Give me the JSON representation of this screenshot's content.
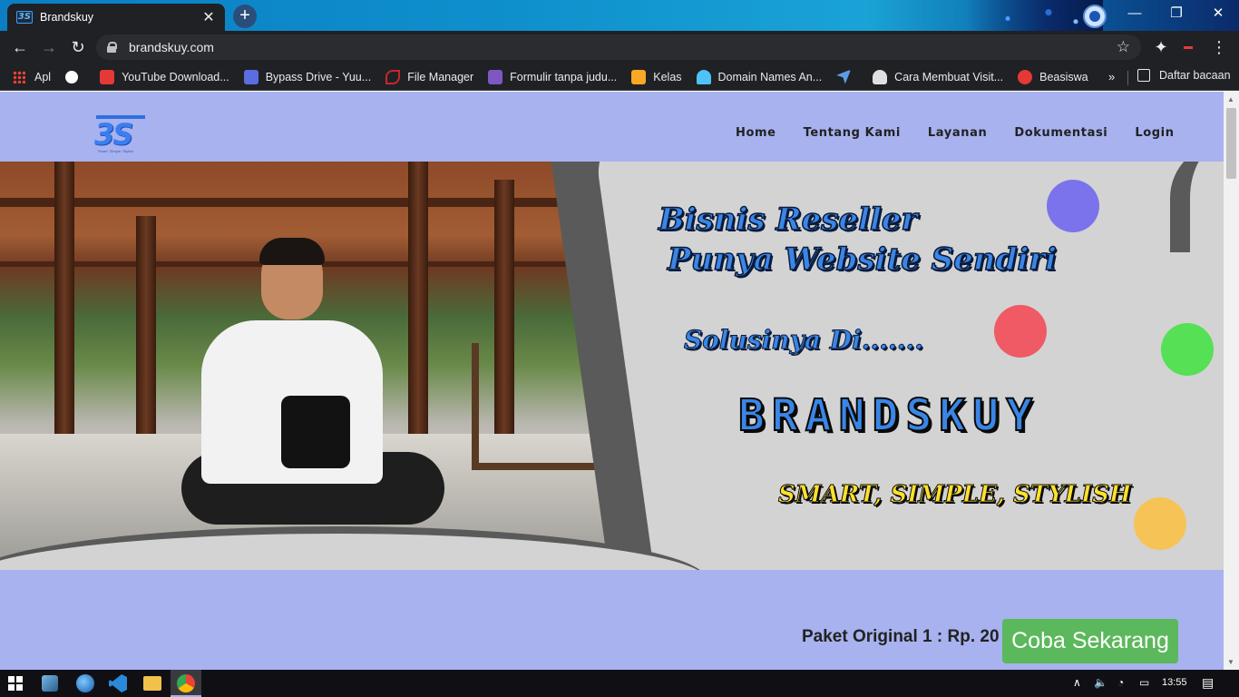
{
  "browser": {
    "tab_title": "Brandskuy",
    "tab_favicon_text": "3S",
    "tab_close": "✕",
    "new_tab": "+",
    "url": "brandskuy.com",
    "window_controls": {
      "minimize": "—",
      "restore": "❐",
      "close": "✕"
    }
  },
  "bookmarks": {
    "items": [
      {
        "label": "Apl",
        "icon": "apps-grid-icon",
        "color": "#ea4335"
      },
      {
        "label": "",
        "icon": "globe-icon",
        "color": "#ffffff"
      },
      {
        "label": "YouTube Download...",
        "icon": "download-icon",
        "color": "#e53935"
      },
      {
        "label": "Bypass Drive - Yuu...",
        "icon": "bypass-icon",
        "color": "#5b6ee1"
      },
      {
        "label": "File Manager",
        "icon": "file-manager-icon",
        "color": "#c62828"
      },
      {
        "label": "Formulir tanpa judu...",
        "icon": "forms-icon",
        "color": "#7e57c2"
      },
      {
        "label": "Kelas",
        "icon": "classroom-icon",
        "color": "#f9a825"
      },
      {
        "label": "Domain Names An...",
        "icon": "domain-icon",
        "color": "#4fc3f7"
      },
      {
        "label": "",
        "icon": "send-icon",
        "color": "#5c9ce6"
      },
      {
        "label": "Cara Membuat Visit...",
        "icon": "user-icon",
        "color": "#e0e0e0"
      },
      {
        "label": "Beasiswa",
        "icon": "beasiswa-icon",
        "color": "#e53935"
      }
    ],
    "more": "»",
    "reading_list": "Daftar bacaan"
  },
  "site": {
    "logo_mark": "3S",
    "logo_tagline": "Smart. Simple. Stylish",
    "nav": [
      "Home",
      "Tentang Kami",
      "Layanan",
      "Dokumentasi",
      "Login"
    ],
    "hero": {
      "line1": "Bisnis Reseller",
      "line2": "Punya Website Sendiri",
      "solusi": "Solusinya Di.......",
      "brand": "BRANDSKUY",
      "slogan": "SMART, SIMPLE, STYLISH"
    },
    "cta_text": "Paket Original 1 : Rp. 20",
    "cta_button": "Coba Sekarang"
  },
  "colors": {
    "page_bg": "#a7b2ef",
    "cta_green": "#5cb85c",
    "dot_purple": "#7b73ec",
    "dot_red": "#ef5a64",
    "dot_green": "#55e055",
    "dot_yellow": "#f6c456"
  },
  "taskbar": {
    "time": "13:55"
  }
}
